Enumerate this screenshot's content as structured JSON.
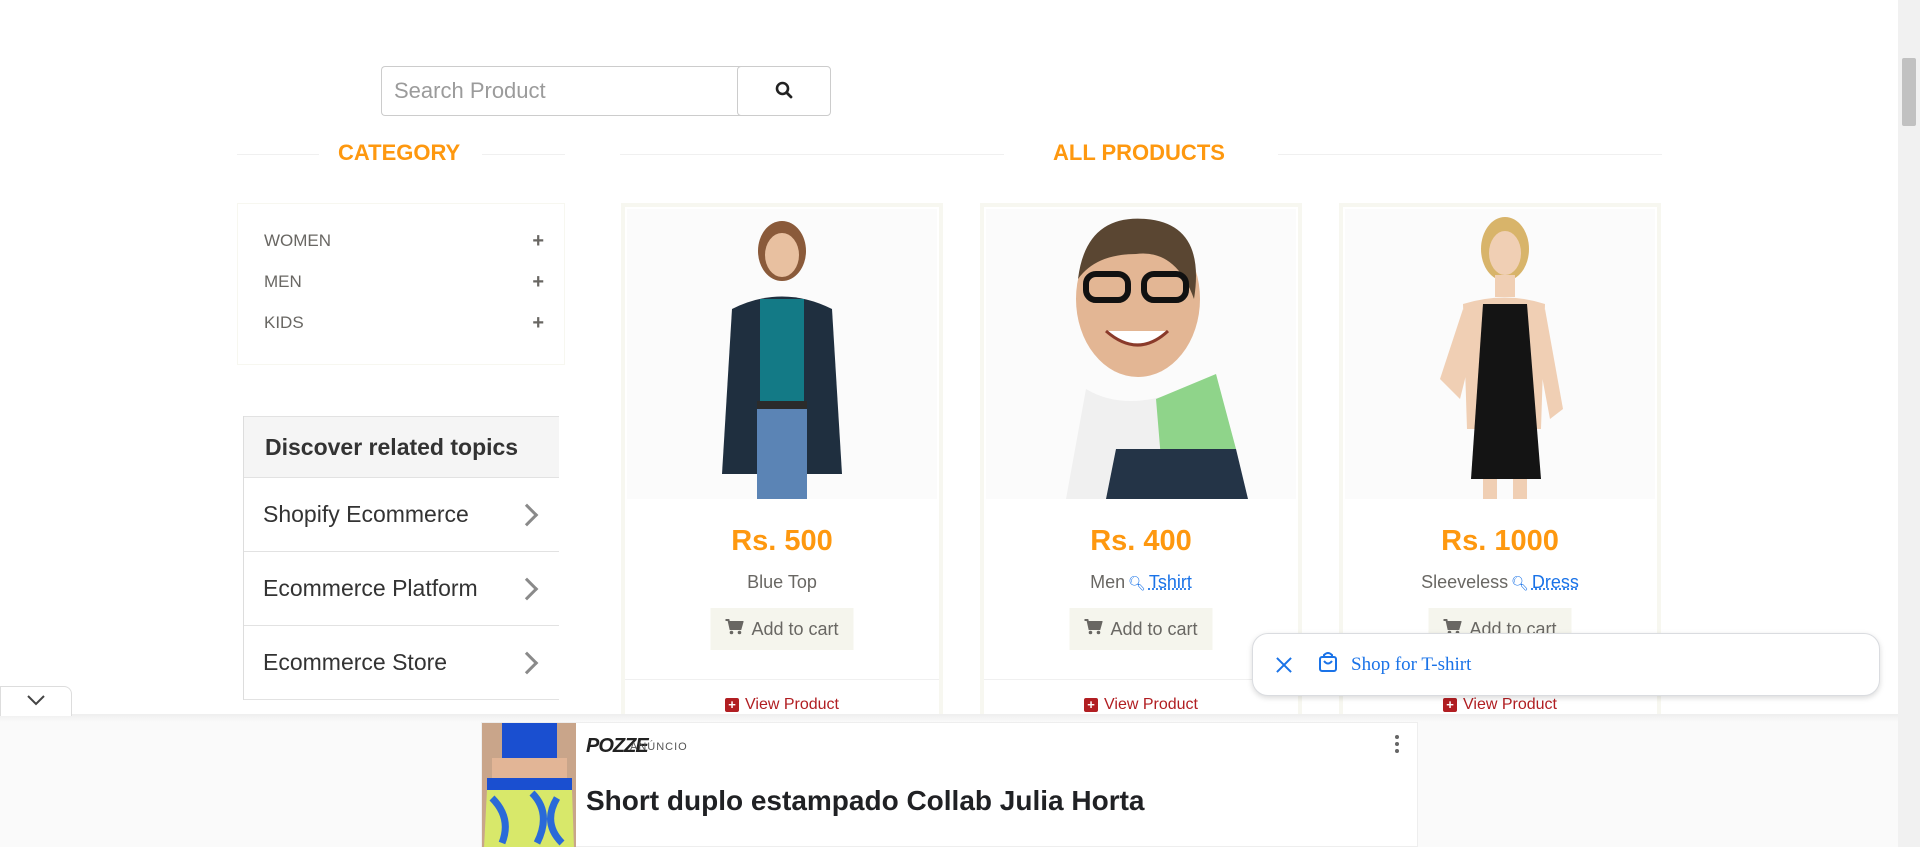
{
  "search": {
    "placeholder": "Search Product",
    "icon": "search-icon"
  },
  "sidebar": {
    "heading": "CATEGORY",
    "categories": [
      {
        "label": "WOMEN"
      },
      {
        "label": "MEN"
      },
      {
        "label": "KIDS"
      }
    ]
  },
  "related": {
    "heading": "Discover related topics",
    "items": [
      {
        "label": "Shopify Ecommerce"
      },
      {
        "label": "Ecommerce Platform"
      },
      {
        "label": "Ecommerce Store"
      }
    ]
  },
  "products": {
    "heading": "ALL PRODUCTS",
    "add_label": "Add to cart",
    "view_label": "View Product",
    "items": [
      {
        "price": "Rs. 500",
        "name": "Blue Top",
        "name_prefix": "",
        "name_link": ""
      },
      {
        "price": "Rs. 400",
        "name": "",
        "name_prefix": "Men",
        "name_link": "Tshirt"
      },
      {
        "price": "Rs. 1000",
        "name": "",
        "name_prefix": "Sleeveless",
        "name_link": "Dress"
      }
    ]
  },
  "shop_popup": {
    "label": "Shop for T-shirt"
  },
  "ad": {
    "brand": "POZZE",
    "label": "ANÚNCIO",
    "title": "Short duplo estampado Collab Julia Horta"
  },
  "colors": {
    "accent": "#fe980f",
    "link": "#1a73e8",
    "view": "#b11e22"
  }
}
